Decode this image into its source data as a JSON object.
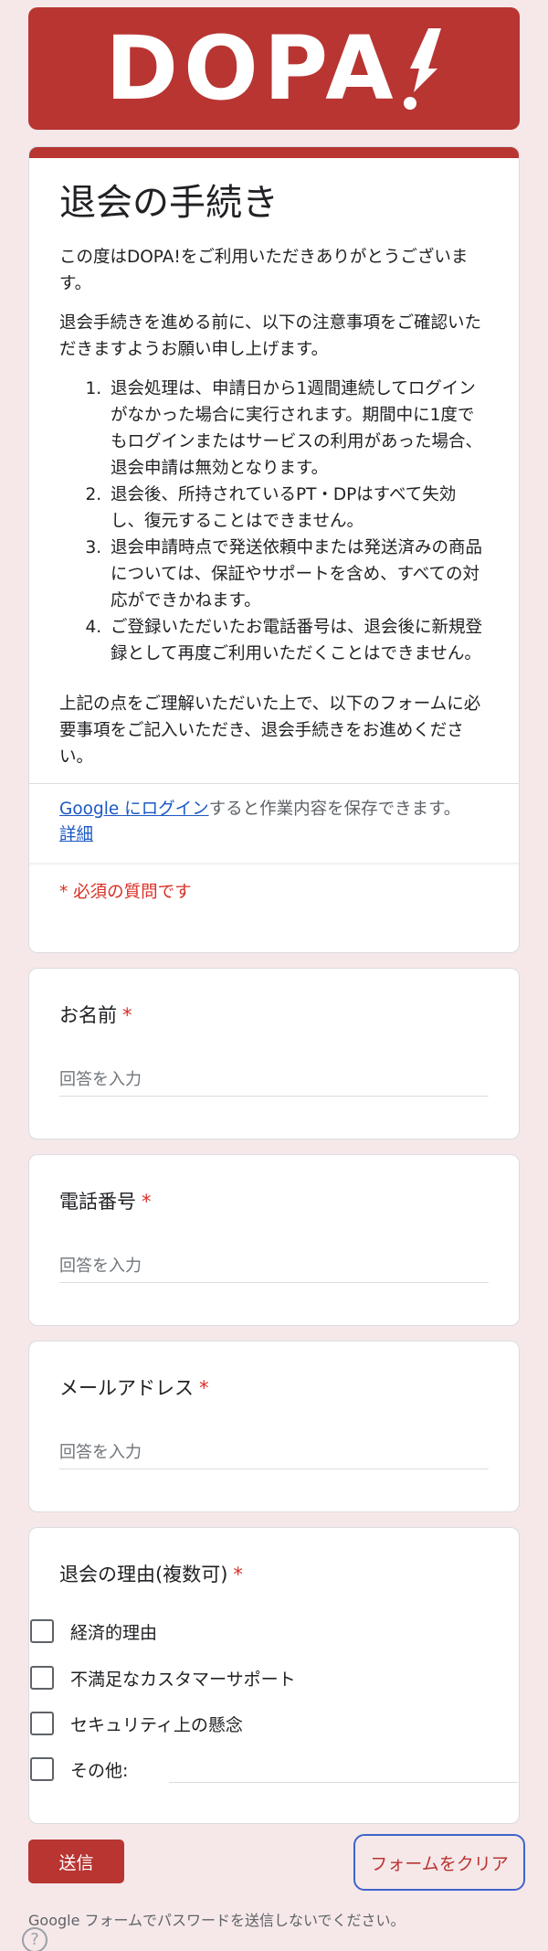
{
  "header": {
    "logo_text": "DOPA"
  },
  "form": {
    "title": "退会の手続き",
    "intro": "この度はDOPA!をご利用いただきありがとうございます。",
    "lead": "退会手続きを進める前に、以下の注意事項をご確認いただきますようお願い申し上げます。",
    "notes": [
      "退会処理は、申請日から1週間連続してログインがなかった場合に実行されます。期間中に1度でもログインまたはサービスの利用があった場合、退会申請は無効となります。",
      "退会後、所持されているPT・DPはすべて失効し、復元することはできません。",
      "退会申請時点で発送依頼中または発送済みの商品については、保証やサポートを含め、すべての対応ができかねます。",
      "ご登録いただいたお電話番号は、退会後に新規登録として再度ご利用いただくことはできません。"
    ],
    "closing": "上記の点をご理解いただいた上で、以下のフォームに必要事項をご記入いただき、退会手続きをお進めください。",
    "login_link": "Google にログイン",
    "login_suffix": "すると作業内容を保存できます。",
    "details_link": "詳細",
    "required_note": "* 必須の質問です"
  },
  "questions": {
    "name": {
      "label": "お名前",
      "placeholder": "回答を入力"
    },
    "phone": {
      "label": "電話番号",
      "placeholder": "回答を入力"
    },
    "email": {
      "label": "メールアドレス",
      "placeholder": "回答を入力"
    },
    "reason": {
      "label": "退会の理由(複数可)",
      "options": [
        "経済的理由",
        "不満足なカスタマーサポート",
        "セキュリティ上の懸念",
        "その他:"
      ]
    },
    "required_mark": "*"
  },
  "actions": {
    "submit_label": "送信",
    "clear_label": "フォームをクリア"
  },
  "footer": {
    "warning": "Google フォームでパスワードを送信しないでください。",
    "help_icon": "?"
  },
  "colors": {
    "accent": "#b83532",
    "background": "#f6e8e9",
    "required": "#d93025",
    "link": "#1a57c4"
  }
}
